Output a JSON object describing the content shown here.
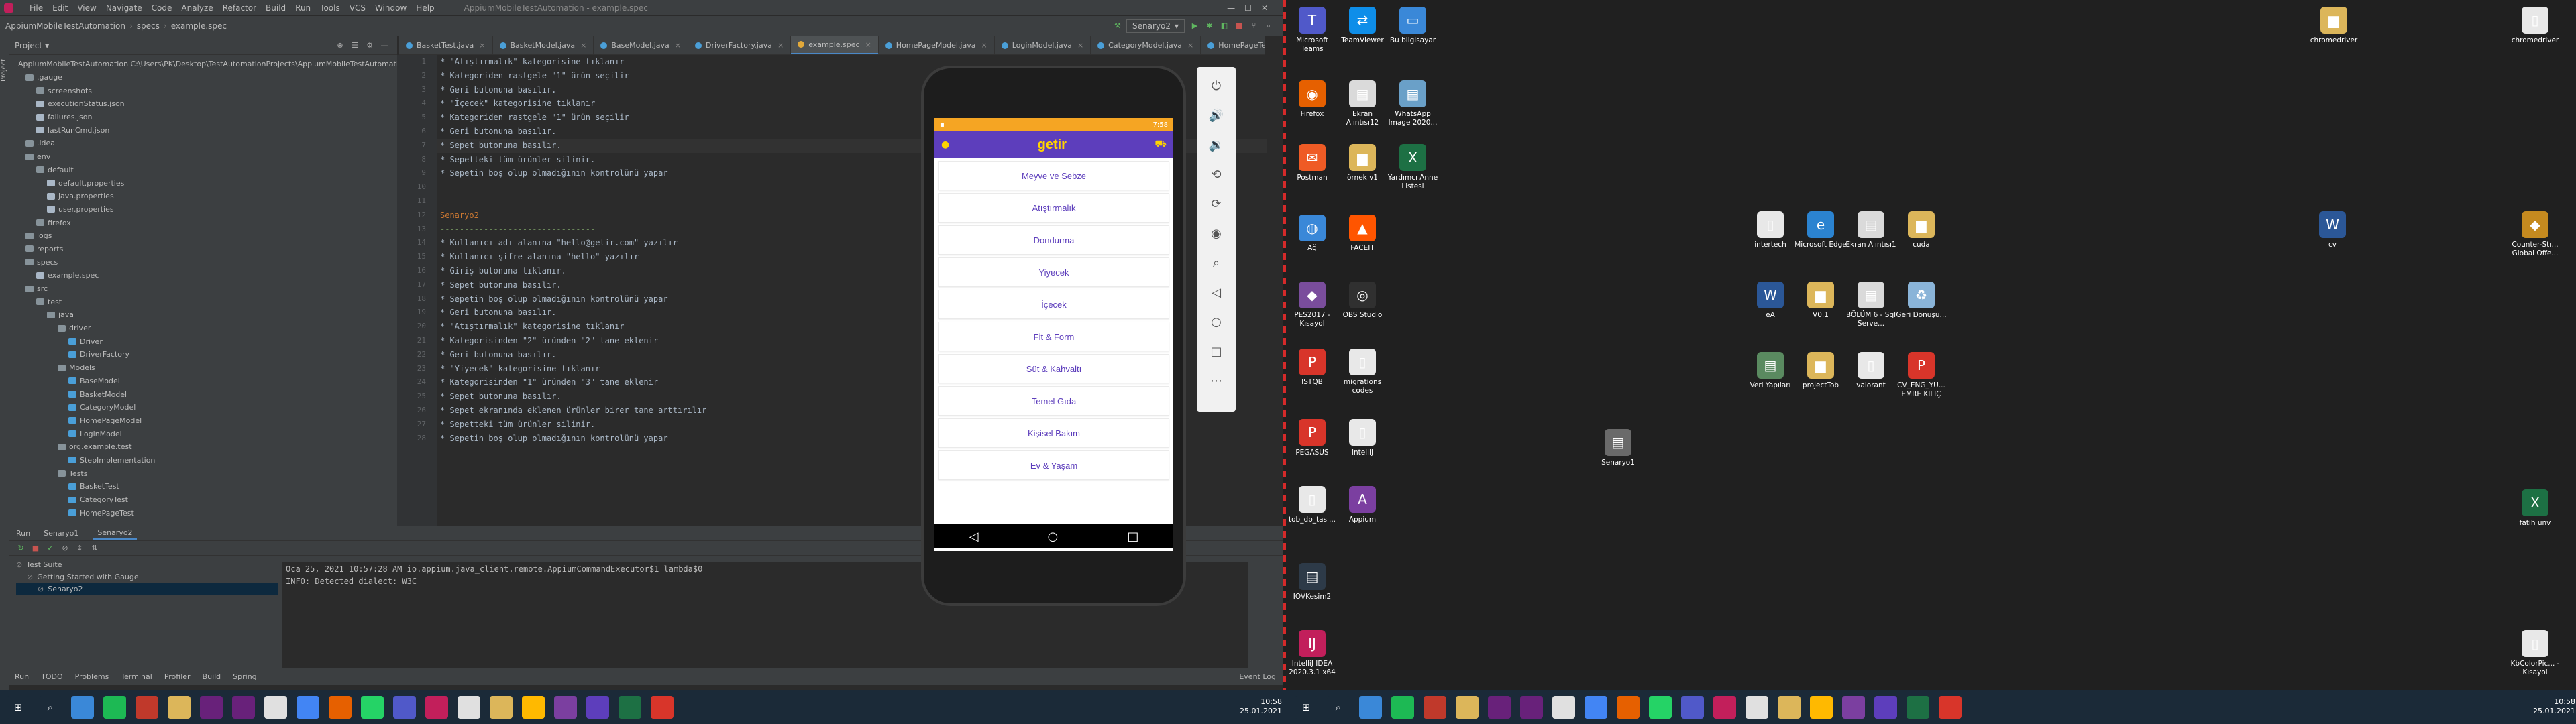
{
  "ide": {
    "window_title": "AppiumMobileTestAutomation - example.spec",
    "menu": [
      "File",
      "Edit",
      "View",
      "Navigate",
      "Code",
      "Analyze",
      "Refactor",
      "Build",
      "Run",
      "Tools",
      "VCS",
      "Window",
      "Help"
    ],
    "breadcrumb": [
      "AppiumMobileTestAutomation",
      "specs",
      "example.spec"
    ],
    "run_config": "Senaryo2",
    "tabs": [
      "BasketTest.java",
      "BasketModel.java",
      "BaseModel.java",
      "DriverFactory.java",
      "example.spec",
      "HomePageModel.java",
      "LoginModel.java",
      "CategoryModel.java",
      "HomePageTest.java"
    ],
    "active_tab": "example.spec",
    "project_label": "Project",
    "tree": [
      {
        "label": "AppiumMobileTestAutomation  C:\\Users\\PK\\Desktop\\TestAutomationProjects\\AppiumMobileTestAutomation",
        "depth": 0,
        "kind": "module"
      },
      {
        "label": ".gauge",
        "depth": 1,
        "kind": "folder"
      },
      {
        "label": "screenshots",
        "depth": 2,
        "kind": "folder"
      },
      {
        "label": "executionStatus.json",
        "depth": 2,
        "kind": "file"
      },
      {
        "label": "failures.json",
        "depth": 2,
        "kind": "file"
      },
      {
        "label": "lastRunCmd.json",
        "depth": 2,
        "kind": "file"
      },
      {
        "label": ".idea",
        "depth": 1,
        "kind": "folder"
      },
      {
        "label": "env",
        "depth": 1,
        "kind": "folder"
      },
      {
        "label": "default",
        "depth": 2,
        "kind": "folder"
      },
      {
        "label": "default.properties",
        "depth": 3,
        "kind": "file"
      },
      {
        "label": "java.properties",
        "depth": 3,
        "kind": "file"
      },
      {
        "label": "user.properties",
        "depth": 3,
        "kind": "file"
      },
      {
        "label": "firefox",
        "depth": 2,
        "kind": "folder"
      },
      {
        "label": "logs",
        "depth": 1,
        "kind": "folder"
      },
      {
        "label": "reports",
        "depth": 1,
        "kind": "folder"
      },
      {
        "label": "specs",
        "depth": 1,
        "kind": "folder"
      },
      {
        "label": "example.spec",
        "depth": 2,
        "kind": "file"
      },
      {
        "label": "src",
        "depth": 1,
        "kind": "folder"
      },
      {
        "label": "test",
        "depth": 2,
        "kind": "folder"
      },
      {
        "label": "java",
        "depth": 3,
        "kind": "folder"
      },
      {
        "label": "driver",
        "depth": 4,
        "kind": "folder"
      },
      {
        "label": "Driver",
        "depth": 5,
        "kind": "class"
      },
      {
        "label": "DriverFactory",
        "depth": 5,
        "kind": "class"
      },
      {
        "label": "Models",
        "depth": 4,
        "kind": "folder"
      },
      {
        "label": "BaseModel",
        "depth": 5,
        "kind": "class"
      },
      {
        "label": "BasketModel",
        "depth": 5,
        "kind": "class"
      },
      {
        "label": "CategoryModel",
        "depth": 5,
        "kind": "class"
      },
      {
        "label": "HomePageModel",
        "depth": 5,
        "kind": "class"
      },
      {
        "label": "LoginModel",
        "depth": 5,
        "kind": "class"
      },
      {
        "label": "org.example.test",
        "depth": 4,
        "kind": "folder"
      },
      {
        "label": "StepImplementation",
        "depth": 5,
        "kind": "class"
      },
      {
        "label": "Tests",
        "depth": 4,
        "kind": "folder"
      },
      {
        "label": "BasketTest",
        "depth": 5,
        "kind": "class"
      },
      {
        "label": "CategoryTest",
        "depth": 5,
        "kind": "class"
      },
      {
        "label": "HomePageTest",
        "depth": 5,
        "kind": "class"
      }
    ],
    "code_start_line": 1,
    "code": [
      {
        "t": "* \"Atıştırmalık\" kategorisine tıklanır",
        "c": ""
      },
      {
        "t": "* Kategoriden rastgele \"1\" ürün seçilir",
        "c": ""
      },
      {
        "t": "* Geri butonuna basılır.",
        "c": ""
      },
      {
        "t": "* \"İçecek\" kategorisine tıklanır",
        "c": ""
      },
      {
        "t": "* Kategoriden rastgele \"1\" ürün seçilir",
        "c": ""
      },
      {
        "t": "* Geri butonuna basılır.",
        "c": ""
      },
      {
        "t": "* Sepet butonuna basılır.",
        "c": "hl"
      },
      {
        "t": "* Sepetteki tüm ürünler silinir.",
        "c": ""
      },
      {
        "t": "* Sepetin boş olup olmadığının kontrolünü yapar",
        "c": ""
      },
      {
        "t": "",
        "c": ""
      },
      {
        "t": "",
        "c": ""
      },
      {
        "t": "Senaryo2",
        "c": "h1"
      },
      {
        "t": "--------------------------------",
        "c": "sep"
      },
      {
        "t": "* Kullanıcı adı alanına \"hello@getir.com\" yazılır",
        "c": ""
      },
      {
        "t": "* Kullanıcı şifre alanına \"hello\" yazılır",
        "c": ""
      },
      {
        "t": "* Giriş butonuna tıklanır.",
        "c": ""
      },
      {
        "t": "* Sepet butonuna basılır.",
        "c": ""
      },
      {
        "t": "* Sepetin boş olup olmadığının kontrolünü yapar",
        "c": ""
      },
      {
        "t": "* Geri butonuna basılır.",
        "c": ""
      },
      {
        "t": "* \"Atıştırmalık\" kategorisine tıklanır",
        "c": ""
      },
      {
        "t": "* Kategorisinden \"2\" üründen \"2\" tane eklenir",
        "c": ""
      },
      {
        "t": "* Geri butonuna basılır.",
        "c": ""
      },
      {
        "t": "* \"Yiyecek\" kategorisine tıklanır",
        "c": ""
      },
      {
        "t": "* Kategorisinden \"1\" üründen \"3\" tane eklenir",
        "c": ""
      },
      {
        "t": "* Sepet butonuna basılır.",
        "c": ""
      },
      {
        "t": "* Sepet ekranında eklenen ürünler birer tane arttırılır",
        "c": ""
      },
      {
        "t": "* Sepetteki tüm ürünler silinir.",
        "c": ""
      },
      {
        "t": "* Sepetin boş olup olmadığının kontrolünü yapar",
        "c": ""
      }
    ],
    "run": {
      "tab_label": "Run",
      "run_tabs": [
        "Senaryo1",
        "Senaryo2"
      ],
      "tree": [
        {
          "label": "Test Suite",
          "depth": 0
        },
        {
          "label": "Getting Started with Gauge",
          "depth": 1
        },
        {
          "label": "Senaryo2",
          "depth": 2
        }
      ],
      "console": [
        "Oca 25, 2021 10:57:28 AM io.appium.java_client.remote.AppiumCommandExecutor$1 lambda$0",
        "INFO: Detected dialect: W3C"
      ]
    },
    "bottom_tabs": [
      "Run",
      "TODO",
      "Problems",
      "Terminal",
      "Profiler",
      "Build",
      "Spring"
    ],
    "event_log": "Event Log"
  },
  "phone": {
    "status_time": "7:58",
    "app_logo": "getir",
    "categories": [
      "Meyve ve Sebze",
      "Atıştırmalık",
      "Dondurma",
      "Yiyecek",
      "İçecek",
      "Fit & Form",
      "Süt & Kahvaltı",
      "Temel Gıda",
      "Kişisel Bakım",
      "Ev & Yaşam"
    ],
    "brand_color": "#5d3ebc",
    "accent_color": "#ffd300"
  },
  "desktop1_icons": [
    {
      "label": "Microsoft Teams",
      "icon": "teams-icon",
      "color": "#5059c9"
    },
    {
      "label": "TeamViewer",
      "icon": "teamviewer-icon",
      "color": "#0e8ee9"
    },
    {
      "label": "Bu bilgisayar",
      "icon": "computer-icon",
      "color": "#3a88d8"
    },
    {
      "label": "Firefox",
      "icon": "firefox-icon",
      "color": "#e66000"
    },
    {
      "label": "Ekran Alıntısı12",
      "icon": "image-icon",
      "color": "#dadada"
    },
    {
      "label": "WhatsApp Image 2020...",
      "icon": "image-icon",
      "color": "#6aa0c8"
    },
    {
      "label": "Postman",
      "icon": "postman-icon",
      "color": "#ef5b25"
    },
    {
      "label": "örnek v1",
      "icon": "folder-icon",
      "color": "#dcb65a"
    },
    {
      "label": "Yardımcı Anne Listesi",
      "icon": "excel-icon",
      "color": "#1d7044"
    },
    {
      "label": "Ağ",
      "icon": "network-icon",
      "color": "#3a88d8"
    },
    {
      "label": "FACEIT",
      "icon": "faceit-icon",
      "color": "#ff5500"
    },
    {
      "label": "PES2017 - Kısayol",
      "icon": "game-icon",
      "color": "#7a4d9c"
    },
    {
      "label": "OBS Studio",
      "icon": "obs-icon",
      "color": "#303030"
    },
    {
      "label": "ISTQB",
      "icon": "pdf-icon",
      "color": "#d8352a"
    },
    {
      "label": "migrations codes",
      "icon": "file-icon",
      "color": "#e8e8e8"
    },
    {
      "label": "PEGASUS",
      "icon": "pdf-icon",
      "color": "#d8352a"
    },
    {
      "label": "intellij",
      "icon": "file-icon",
      "color": "#e8e8e8"
    },
    {
      "label": "tob_db_tasl...",
      "icon": "file-icon",
      "color": "#e8e8e8"
    },
    {
      "label": "Appium",
      "icon": "appium-icon",
      "color": "#7b3fa0"
    },
    {
      "label": "IOVKesim2",
      "icon": "image-icon",
      "color": "#2d3a48"
    },
    {
      "label": "IntelliJ IDEA 2020.3.1 x64",
      "icon": "intellij-icon",
      "color": "#c21f5b"
    }
  ],
  "desktop2_icons": [
    {
      "label": "chromedriver",
      "icon": "folder-icon",
      "color": "#dcb65a"
    },
    {
      "label": "chromedriver",
      "icon": "file-icon",
      "color": "#e8e8e8"
    },
    {
      "label": "intertech",
      "icon": "file-icon",
      "color": "#e8e8e8"
    },
    {
      "label": "Microsoft Edge",
      "icon": "edge-icon",
      "color": "#2b83d0"
    },
    {
      "label": "Ekran Alıntısı1",
      "icon": "image-icon",
      "color": "#dadada"
    },
    {
      "label": "cuda",
      "icon": "folder-icon",
      "color": "#dcb65a"
    },
    {
      "label": "cv",
      "icon": "word-icon",
      "color": "#2b5797"
    },
    {
      "label": "Counter-Str... Global Offe...",
      "icon": "game-icon",
      "color": "#c58a1f"
    },
    {
      "label": "eA",
      "icon": "word-icon",
      "color": "#2b5797"
    },
    {
      "label": "V0.1",
      "icon": "folder-icon",
      "color": "#dcb65a"
    },
    {
      "label": "BÖLÜM 6 - Sql Serve...",
      "icon": "image-icon",
      "color": "#dadada"
    },
    {
      "label": "Geri Dönüşü...",
      "icon": "recycle-icon",
      "color": "#8ab4d8"
    },
    {
      "label": "Veri Yapıları",
      "icon": "image-icon",
      "color": "#5a8a60"
    },
    {
      "label": "projectTob",
      "icon": "folder-icon",
      "color": "#dcb65a"
    },
    {
      "label": "valorant",
      "icon": "file-icon",
      "color": "#e8e8e8"
    },
    {
      "label": "CV_ENG_YU... EMRE KILIÇ",
      "icon": "pdf-icon",
      "color": "#d8352a"
    },
    {
      "label": "Senaryo1",
      "icon": "image-icon",
      "color": "#6a6a6a"
    },
    {
      "label": "fatih unv",
      "icon": "excel-icon",
      "color": "#1d7044"
    },
    {
      "label": "KbColorPic... - Kısayol",
      "icon": "file-icon",
      "color": "#e8e8e8"
    }
  ],
  "clock1": {
    "time": "10:58",
    "date": "25.01.2021"
  },
  "clock2": {
    "time": "10:58",
    "date": "25.01.2021"
  }
}
